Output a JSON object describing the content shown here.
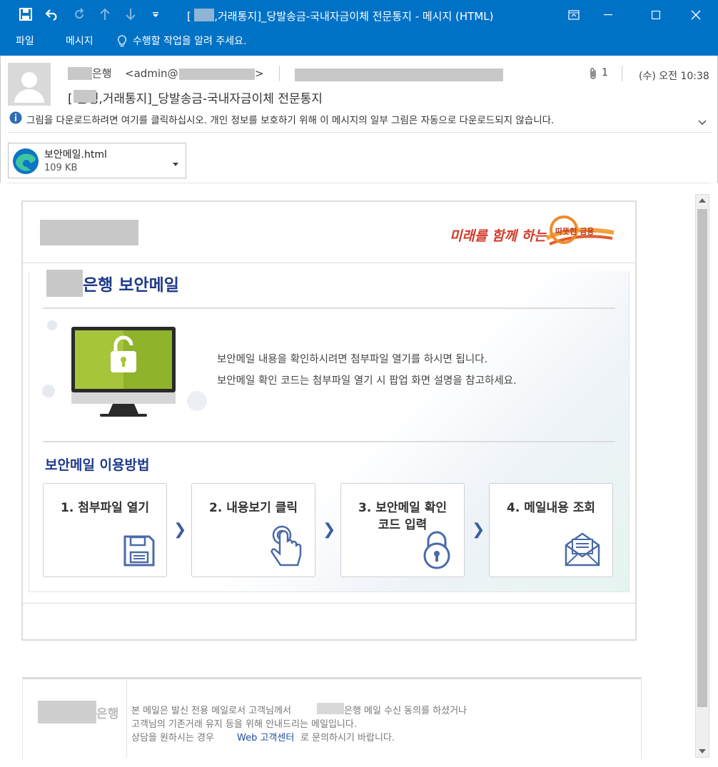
{
  "window": {
    "title": "[    은행,거래통지]_당발송금-국내자금이체 전문통지 - 메시지 (HTML)"
  },
  "ribbon": {
    "tabs": [
      "파일",
      "메시지"
    ],
    "tell_me": "수행할 작업을 알려 주세요."
  },
  "message": {
    "sender_name": "은행",
    "sender_email": "<admin@",
    "sender_email_end": ">",
    "attachment_count": "1",
    "date": "(수) 오전 10:38",
    "subject": "[    은행,거래통지]_당발송금-국내자금이체 전문통지",
    "info_bar": "그림을 다운로드하려면 여기를 클릭하십시오. 개인 정보를 보호하기 위해 이 메시지의 일부 그림은 자동으로 다운로드되지 않습니다.",
    "attachment": {
      "name": "보안메일.html",
      "size": "109 KB"
    }
  },
  "body": {
    "slogan": "미래를 함께 하는",
    "slogan_badge": "따뜻한 금융",
    "heading": "은행 보안메일",
    "instruction_line1": "보안메일 내용을 확인하시려면 첨부파일 열기를 하시면 됩니다.",
    "instruction_line2": "보안메일 확인 코드는 첨부파일 열기 시 팝업 화면 설명을 참고하세요.",
    "howto_title": "보안메일 이용방법",
    "steps": [
      {
        "label": "1. 첨부파일 열기"
      },
      {
        "label": "2. 내용보기 클릭"
      },
      {
        "label": "3. 보안메일 확인\n코드 입력"
      },
      {
        "label": "4. 메일내용 조회"
      }
    ]
  },
  "footer": {
    "bank_label": "은행",
    "line1_a": "본 메일은 발신 전용 메일로서 고객님께서",
    "line1_b": "은행 메일 수신 동의를 하셨거나",
    "line2": "고객님의 기존거래 유지 등을 위해 안내드리는 메일입니다.",
    "line3_a": "상담을 원하시는 경우",
    "line3_link": "Web 고객센터",
    "line3_b": "로 문의하시기 바랍니다."
  },
  "colors": {
    "titlebar": "#0072c6",
    "accent_navy": "#1e3a8a",
    "step_icon": "#4a6aa8",
    "monitor_screen": "#a6c53a"
  }
}
